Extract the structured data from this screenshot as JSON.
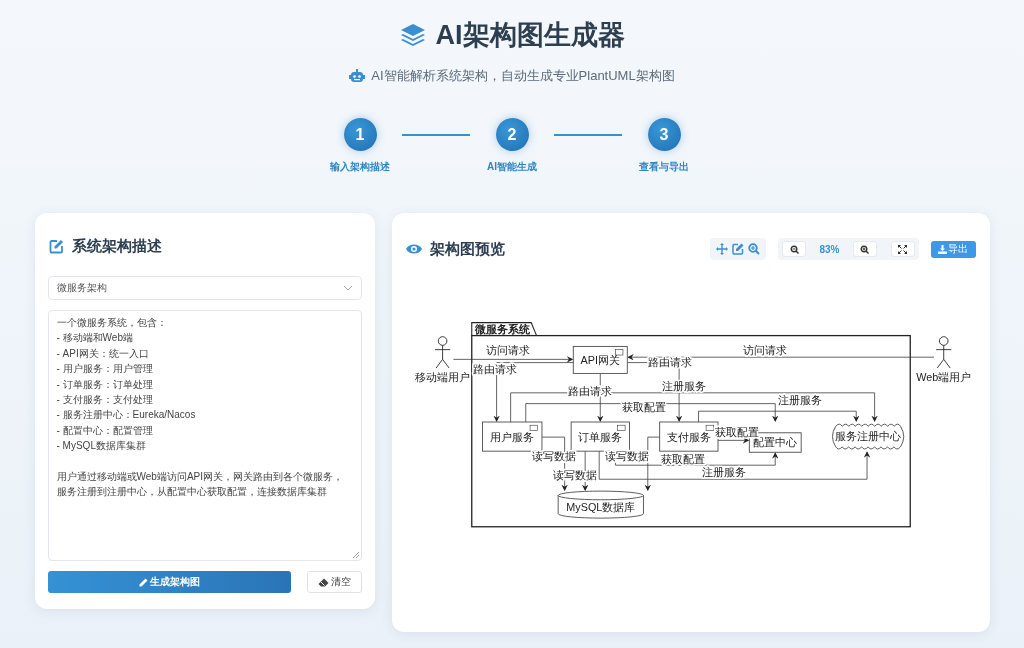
{
  "header": {
    "title": "AI架构图生成器",
    "subtitle": "AI智能解析系统架构，自动生成专业PlantUML架构图"
  },
  "steps": [
    {
      "number": "1",
      "label": "输入架构描述"
    },
    {
      "number": "2",
      "label": "AI智能生成"
    },
    {
      "number": "3",
      "label": "查看与导出"
    }
  ],
  "input_panel": {
    "title": "系统架构描述",
    "template_select": {
      "value": "微服务架构"
    },
    "description": {
      "paragraphs": [
        "一个微服务系统，包含：\n- 移动端和Web端\n- API网关：统一入口\n- 用户服务：用户管理\n- 订单服务：订单处理\n- 支付服务：支付处理\n- 服务注册中心：Eureka/Nacos\n- 配置中心：配置管理\n- MySQL数据库集群",
        "用户通过移动端或Web端访问API网关，网关路由到各个微服务，服务注册到注册中心，从配置中心获取配置，连接数据库集群"
      ]
    },
    "buttons": [
      {
        "kind": "primary",
        "label": "生成架构图"
      },
      {
        "kind": "secondary",
        "label": "清空"
      }
    ]
  },
  "preview_panel": {
    "title": "架构图预览",
    "zoom": "83%",
    "export_label": "导出",
    "diagram": {
      "package": "微服务系统",
      "nodes": [
        {
          "kind": "actor",
          "label": "移动端用户"
        },
        {
          "kind": "actor",
          "label": "Web端用户"
        },
        {
          "kind": "component",
          "label": "API网关"
        },
        {
          "kind": "component",
          "label": "用户服务"
        },
        {
          "kind": "component",
          "label": "订单服务"
        },
        {
          "kind": "component",
          "label": "支付服务"
        },
        {
          "kind": "rectangle",
          "label": "配置中心"
        },
        {
          "kind": "cloud",
          "label": "服务注册中心"
        },
        {
          "kind": "database",
          "label": "MySQL数据库"
        }
      ],
      "edges": [
        {
          "label": "访问请求"
        },
        {
          "label": "访问请求"
        },
        {
          "label": "路由请求"
        },
        {
          "label": "路由请求"
        },
        {
          "label": "路由请求"
        },
        {
          "label": "注册服务"
        },
        {
          "label": "获取配置"
        },
        {
          "label": "注册服务"
        },
        {
          "label": "获取配置"
        },
        {
          "label": "读写数据"
        },
        {
          "label": "读写数据"
        },
        {
          "label": "读写数据"
        },
        {
          "label": "获取配置"
        },
        {
          "label": "注册服务"
        }
      ]
    }
  }
}
